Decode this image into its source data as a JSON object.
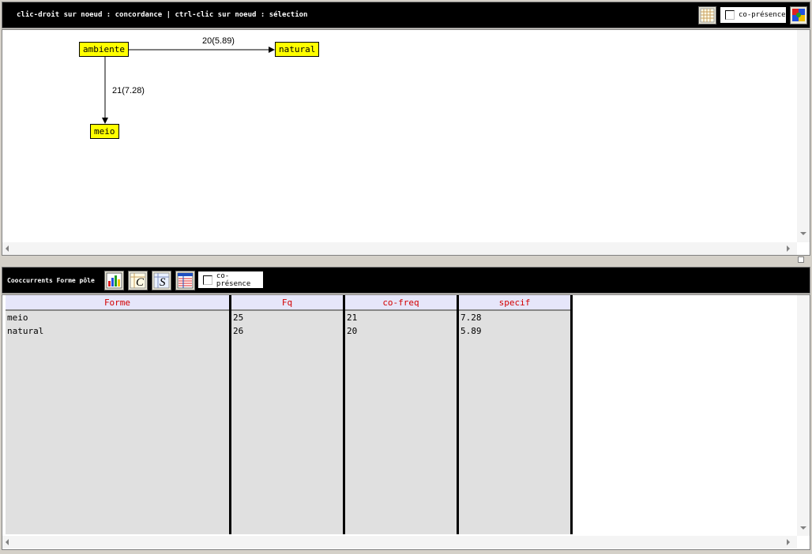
{
  "graph_toolbar": {
    "hint": "clic-droit sur noeud : concordance | ctrl-clic sur noeud : sélection",
    "copresence_label": "co-présence",
    "copresence_checked": false
  },
  "graph": {
    "nodes": [
      {
        "id": "ambiente",
        "label": "ambiente"
      },
      {
        "id": "natural",
        "label": "natural"
      },
      {
        "id": "meio",
        "label": "meio"
      }
    ],
    "edges": [
      {
        "from": "ambiente",
        "to": "natural",
        "label": "20(5.89)"
      },
      {
        "from": "ambiente",
        "to": "meio",
        "label": "21(7.28)"
      }
    ]
  },
  "table_toolbar": {
    "title": "Cooccurrents Forme pôle",
    "copresence_label": "co-présence",
    "copresence_checked": false
  },
  "table": {
    "columns": [
      "Forme",
      "Fq",
      "co-freq",
      "specif"
    ],
    "rows": [
      [
        "meio",
        "25",
        "21",
        "7.28"
      ],
      [
        "natural",
        "26",
        "20",
        "5.89"
      ]
    ]
  }
}
